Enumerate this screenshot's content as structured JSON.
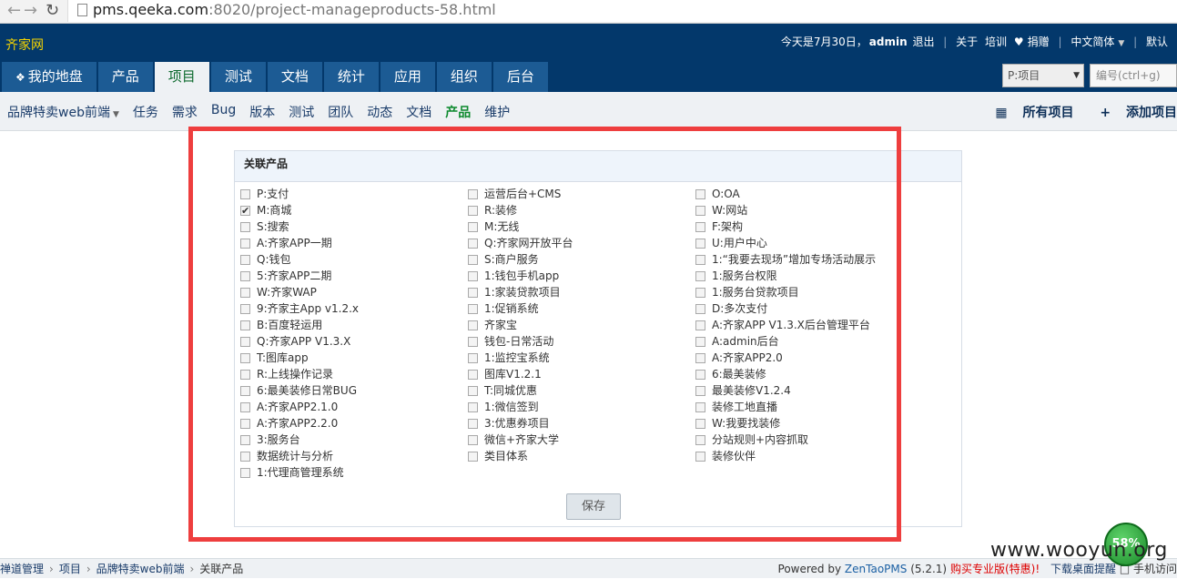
{
  "browser": {
    "url_host": "pms.qeeka.com",
    "url_rest": ":8020/project-manageproducts-58.html"
  },
  "header": {
    "brand": "齐家网",
    "greeting": "今天是7月30日，",
    "user": "admin",
    "logout": "退出",
    "about": "关于",
    "training": "培训",
    "donate": "捐赠",
    "language": "中文简体",
    "default": "默认"
  },
  "main_nav": [
    {
      "label": "我的地盘",
      "icon": "home-icon"
    },
    {
      "label": "产品"
    },
    {
      "label": "项目",
      "active": true
    },
    {
      "label": "测试"
    },
    {
      "label": "文档"
    },
    {
      "label": "统计"
    },
    {
      "label": "应用"
    },
    {
      "label": "组织"
    },
    {
      "label": "后台"
    }
  ],
  "search": {
    "project_select": "P:项目",
    "placeholder": "编号(ctrl+g)"
  },
  "sub_nav": {
    "project": "品牌特卖web前端",
    "items": [
      "任务",
      "需求",
      "Bug",
      "版本",
      "测试",
      "团队",
      "动态",
      "文档",
      "产品",
      "维护"
    ],
    "active_index": 8,
    "all_projects": "所有项目",
    "add_project": "添加项目"
  },
  "panel": {
    "title": "关联产品",
    "columns": [
      [
        {
          "label": "P:支付",
          "checked": false
        },
        {
          "label": "M:商城",
          "checked": true
        },
        {
          "label": "S:搜索",
          "checked": false
        },
        {
          "label": "A:齐家APP一期",
          "checked": false
        },
        {
          "label": "Q:钱包",
          "checked": false
        },
        {
          "label": "5:齐家APP二期",
          "checked": false
        },
        {
          "label": "W:齐家WAP",
          "checked": false
        },
        {
          "label": "9:齐家主App v1.2.x",
          "checked": false
        },
        {
          "label": "B:百度轻运用",
          "checked": false
        },
        {
          "label": "Q:齐家APP V1.3.X",
          "checked": false
        },
        {
          "label": "T:图库app",
          "checked": false
        },
        {
          "label": "R:上线操作记录",
          "checked": false
        },
        {
          "label": "6:最美装修日常BUG",
          "checked": false
        },
        {
          "label": "A:齐家APP2.1.0",
          "checked": false
        },
        {
          "label": "A:齐家APP2.2.0",
          "checked": false
        },
        {
          "label": "3:服务台",
          "checked": false
        },
        {
          "label": "数据统计与分析",
          "checked": false
        },
        {
          "label": "1:代理商管理系统",
          "checked": false
        }
      ],
      [
        {
          "label": "运营后台+CMS",
          "checked": false
        },
        {
          "label": "R:装修",
          "checked": false
        },
        {
          "label": "M:无线",
          "checked": false
        },
        {
          "label": "Q:齐家网开放平台",
          "checked": false
        },
        {
          "label": "S:商户服务",
          "checked": false
        },
        {
          "label": "1:钱包手机app",
          "checked": false
        },
        {
          "label": "1:家装贷款项目",
          "checked": false
        },
        {
          "label": "1:促销系统",
          "checked": false
        },
        {
          "label": "齐家宝",
          "checked": false
        },
        {
          "label": "钱包-日常活动",
          "checked": false
        },
        {
          "label": "1:监控宝系统",
          "checked": false
        },
        {
          "label": "图库V1.2.1",
          "checked": false
        },
        {
          "label": "T:同城优惠",
          "checked": false
        },
        {
          "label": "1:微信签到",
          "checked": false
        },
        {
          "label": "3:优惠券项目",
          "checked": false
        },
        {
          "label": "微信+齐家大学",
          "checked": false
        },
        {
          "label": "类目体系",
          "checked": false
        }
      ],
      [
        {
          "label": "O:OA",
          "checked": false
        },
        {
          "label": "W:网站",
          "checked": false
        },
        {
          "label": "F:架构",
          "checked": false
        },
        {
          "label": "U:用户中心",
          "checked": false
        },
        {
          "label": "1:“我要去现场”增加专场活动展示",
          "checked": false
        },
        {
          "label": "1:服务台权限",
          "checked": false
        },
        {
          "label": "1:服务台贷款项目",
          "checked": false
        },
        {
          "label": "D:多次支付",
          "checked": false
        },
        {
          "label": "A:齐家APP V1.3.X后台管理平台",
          "checked": false
        },
        {
          "label": "A:admin后台",
          "checked": false
        },
        {
          "label": "A:齐家APP2.0",
          "checked": false
        },
        {
          "label": "6:最美装修",
          "checked": false
        },
        {
          "label": "最美装修V1.2.4",
          "checked": false
        },
        {
          "label": "装修工地直播",
          "checked": false
        },
        {
          "label": "W:我要找装修",
          "checked": false
        },
        {
          "label": "分站规则+内容抓取",
          "checked": false
        },
        {
          "label": "装修伙伴",
          "checked": false
        }
      ]
    ],
    "save_label": "保存"
  },
  "footer": {
    "breadcrumbs": [
      "禅道管理",
      "项目",
      "品牌特卖web前端",
      "关联产品"
    ],
    "powered_by": "Powered by",
    "zentao": "ZenTaoPMS",
    "version": "(5.2.1)",
    "buy_pro": "购买专业版(特惠)!",
    "download": "下载桌面提醒",
    "mobile": "手机访问"
  },
  "overlay": {
    "badge_percent": "58%",
    "watermark": "www.wooyun.org",
    "highlight_color": "#ee3e3e"
  }
}
